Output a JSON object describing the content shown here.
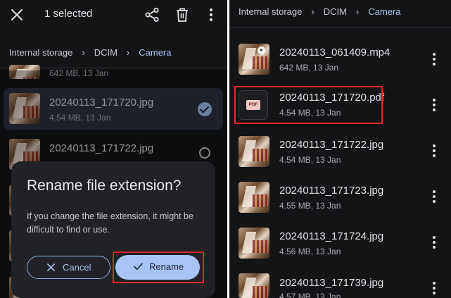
{
  "left": {
    "topbar": {
      "selected_label": "1 selected"
    },
    "breadcrumb": [
      "Internal storage",
      "DCIM",
      "Camera"
    ],
    "partial_meta": "642 MB, 13 Jan",
    "selected_file": {
      "name": "20240113_171720.jpg",
      "meta": "4.54 MB, 13 Jan"
    },
    "next_file": {
      "name": "20240113_171722.jpg"
    },
    "dialog": {
      "title": "Rename file extension?",
      "body": "If you change the file extension, it might be difficult to find or use.",
      "cancel_label": "Cancel",
      "rename_label": "Rename"
    }
  },
  "right": {
    "breadcrumb": [
      "Internal storage",
      "DCIM",
      "Camera"
    ],
    "files": [
      {
        "name": "20240113_061409.mp4",
        "meta": "642 MB, 13 Jan",
        "kind": "video"
      },
      {
        "name": "20240113_171720.pdf",
        "meta": "4.54 MB, 13 Jan",
        "kind": "pdf",
        "badge": "PDF"
      },
      {
        "name": "20240113_171722.jpg",
        "meta": "4.54 MB, 13 Jan",
        "kind": "image"
      },
      {
        "name": "20240113_171723.jpg",
        "meta": "4.55 MB, 13 Jan",
        "kind": "image"
      },
      {
        "name": "20240113_171724.jpg",
        "meta": "4.56 MB, 13 Jan",
        "kind": "image"
      },
      {
        "name": "20240113_171739.jpg",
        "meta": "4.57 MB, 13 Jan",
        "kind": "image"
      }
    ]
  },
  "colors": {
    "accent": "#a8c4f5",
    "highlight": "#e0282e",
    "background": "#131416"
  }
}
